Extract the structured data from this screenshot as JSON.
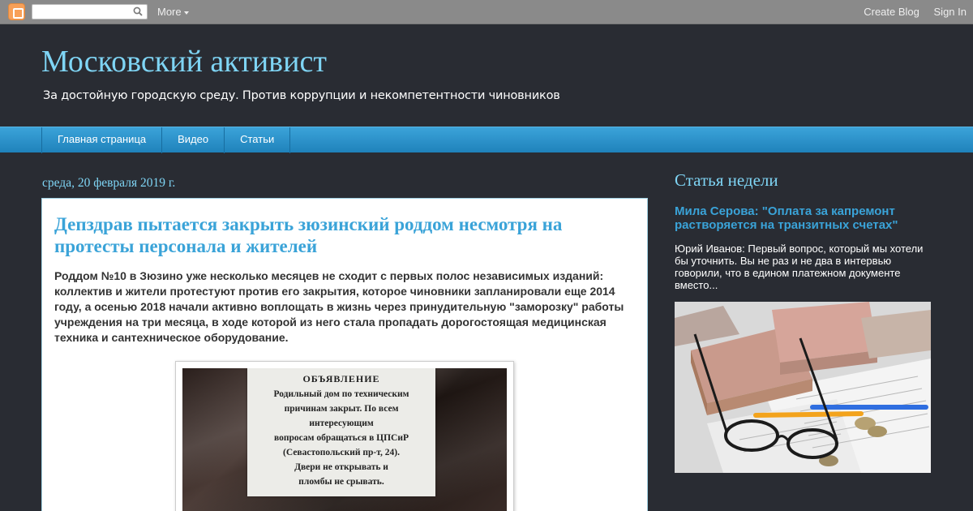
{
  "navbar": {
    "more_label": "More",
    "create_blog_label": "Create Blog",
    "sign_in_label": "Sign In"
  },
  "header": {
    "title": "Московский активист",
    "description": "За достойную городскую среду. Против коррупции и некомпетентности чиновников"
  },
  "tabs": [
    {
      "label": "Главная страница"
    },
    {
      "label": "Видео"
    },
    {
      "label": "Статьи"
    }
  ],
  "post": {
    "date": "среда, 20 февраля 2019 г.",
    "title": "Депздрав пытается закрыть зюзинский роддом несмотря на протесты персонала и жителей",
    "summary": "Роддом №10 в Зюзино уже несколько месяцев не сходит с первых полос независимых изданий: коллектив и жители протестуют против его закрытия, которое чиновники запланировали еще 2014 году, а осенью 2018 начали активно воплощать в жизнь через принудительную \"заморозку\" работы учреждения на три месяца, в ходе которой из него стала пропадать дорогостоящая медицинская техника и сантехническое оборудование.",
    "notice": {
      "title": "ОБЪЯВЛЕНИЕ",
      "lines": [
        "Родильный дом по техническим",
        "причинам закрыт. По всем",
        "интересующим",
        "вопросам обращаться в ЦПСиР",
        "(Севастопольский пр-т, 24).",
        "Двери не открывать и",
        "пломбы не срывать."
      ]
    }
  },
  "sidebar": {
    "widget_title": "Статья недели",
    "featured_title": "Мила Серова: \"Оплата за капремонт растворяется на транзитных счетах\"",
    "featured_snippet": "Юрий Иванов: Первый вопрос, который мы хотели бы уточнить. Вы не раз и не два в интервью говорили, что в едином платежном документе вместо..."
  },
  "colors": {
    "background": "#292c33",
    "accent_light": "#7fd5f5",
    "link": "#3aa3d8",
    "tab_bar": "#2b93ca"
  }
}
